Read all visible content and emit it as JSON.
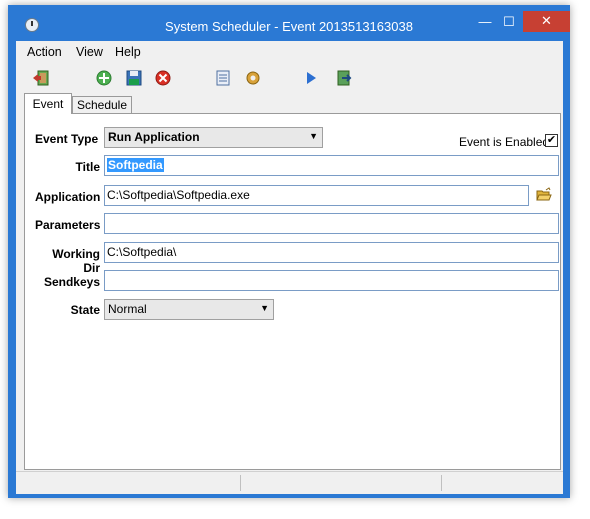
{
  "window": {
    "title": "System Scheduler - Event 2013513163038"
  },
  "titlebar_buttons": {
    "minimize": "—",
    "maximize": "☐",
    "close": "✕"
  },
  "menu": [
    "Action",
    "View",
    "Help"
  ],
  "toolbar": [
    "exit-icon",
    "add-event-icon",
    "save-icon",
    "delete-icon",
    "list-icon",
    "settings-icon",
    "play-icon",
    "export-icon"
  ],
  "tabs": [
    "Event",
    "Schedule"
  ],
  "form": {
    "event_type_label": "Event Type",
    "event_type_value": "Run Application",
    "enabled_label": "Event is Enabled",
    "enabled_check": "✔",
    "title_label": "Title",
    "title_value": "Softpedia",
    "application_label": "Application",
    "application_value": "C:\\Softpedia\\Softpedia.exe",
    "parameters_label": "Parameters",
    "parameters_value": "",
    "working_dir_label": "Working Dir",
    "working_dir_value": "C:\\Softpedia\\",
    "sendkeys_label": "Sendkeys",
    "sendkeys_value": "",
    "state_label": "State",
    "state_value": "Normal"
  },
  "colors": {
    "titlebar": "#2b79d4",
    "close_button": "#c74033",
    "field_border": "#7a9cc6",
    "highlight": "#3399ff"
  }
}
